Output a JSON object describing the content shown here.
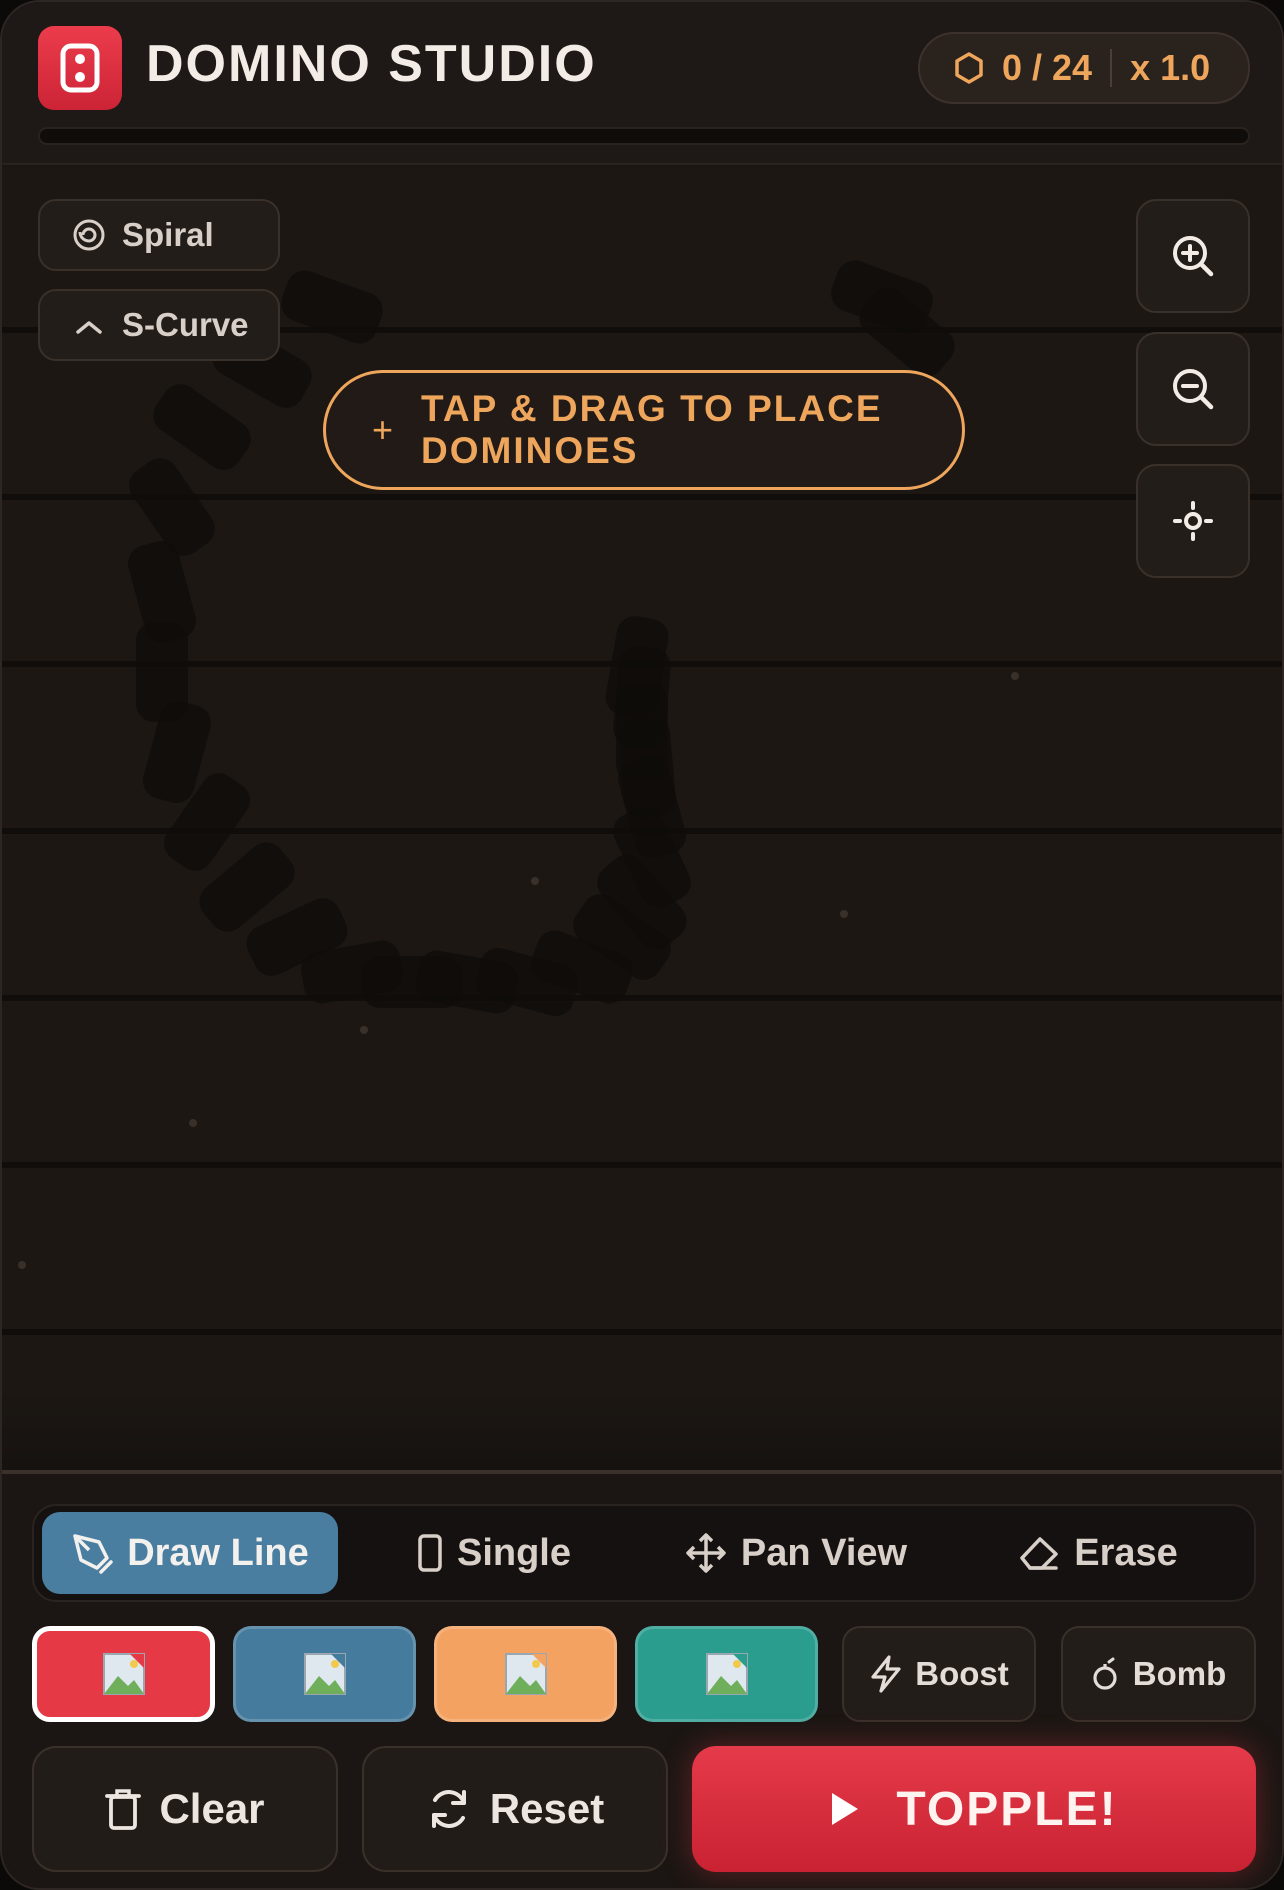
{
  "header": {
    "title": "DOMINO STUDIO",
    "logo_icon": "domino-icon",
    "count": "0 / 24",
    "multiplier": "x 1.0",
    "count_icon": "hexagon-icon",
    "progress": 0
  },
  "presets": [
    {
      "label": "Spiral",
      "icon": "spiral-icon"
    },
    {
      "label": "S-Curve",
      "icon": "chevron-up-icon"
    }
  ],
  "hint": {
    "icon": "plus-icon",
    "line1": "TAP & DRAG TO PLACE",
    "line2": "DOMINOES"
  },
  "view_controls": [
    "zoom-in-icon",
    "zoom-out-icon",
    "recenter-icon"
  ],
  "modes": [
    {
      "label": "Draw Line",
      "icon": "pen-icon",
      "active": true
    },
    {
      "label": "Single",
      "icon": "domino-outline-icon",
      "active": false
    },
    {
      "label": "Pan View",
      "icon": "move-icon",
      "active": false
    },
    {
      "label": "Erase",
      "icon": "eraser-icon",
      "active": false
    }
  ],
  "colors": [
    {
      "hex": "#e63946",
      "selected": true
    },
    {
      "hex": "#457b9d",
      "selected": false
    },
    {
      "hex": "#f4a261",
      "selected": false
    },
    {
      "hex": "#2a9d8f",
      "selected": false
    }
  ],
  "powerups": [
    {
      "label": "Boost",
      "icon": "lightning-icon"
    },
    {
      "label": "Bomb",
      "icon": "bomb-icon"
    }
  ],
  "actions": {
    "clear": "Clear",
    "reset": "Reset",
    "topple": "TOPPLE!"
  },
  "theme": {
    "accent": "#eea55c",
    "primary": "#e63946",
    "active_mode": "#4a7ea0"
  }
}
